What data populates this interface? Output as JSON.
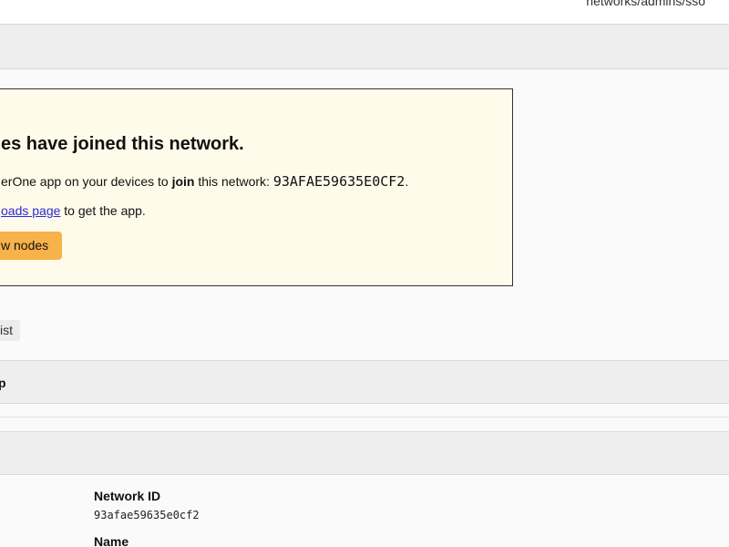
{
  "topbar": {
    "breadcrumb_path": "networks/admins/sso"
  },
  "notice": {
    "title": "es have joined this network.",
    "line1_prefix": "erOne app on your devices to ",
    "line1_bold": "join",
    "line1_middle": " this network: ",
    "network_id_upper": "93AFAE59635E0CF2",
    "line1_suffix": ".",
    "line2_link": "oads page",
    "line2_suffix": " to get the app.",
    "button_label": "w nodes"
  },
  "list_chip": {
    "label": "ist"
  },
  "section_band": {
    "label": "p"
  },
  "settings": {
    "network_id_label": "Network ID",
    "network_id_value": "93afae59635e0cf2",
    "name_label": "Name"
  },
  "colors": {
    "notice_background": "#fffbea",
    "button_background": "#f7b24a",
    "link": "#2a2ad8",
    "band_background": "#eeeeee"
  }
}
